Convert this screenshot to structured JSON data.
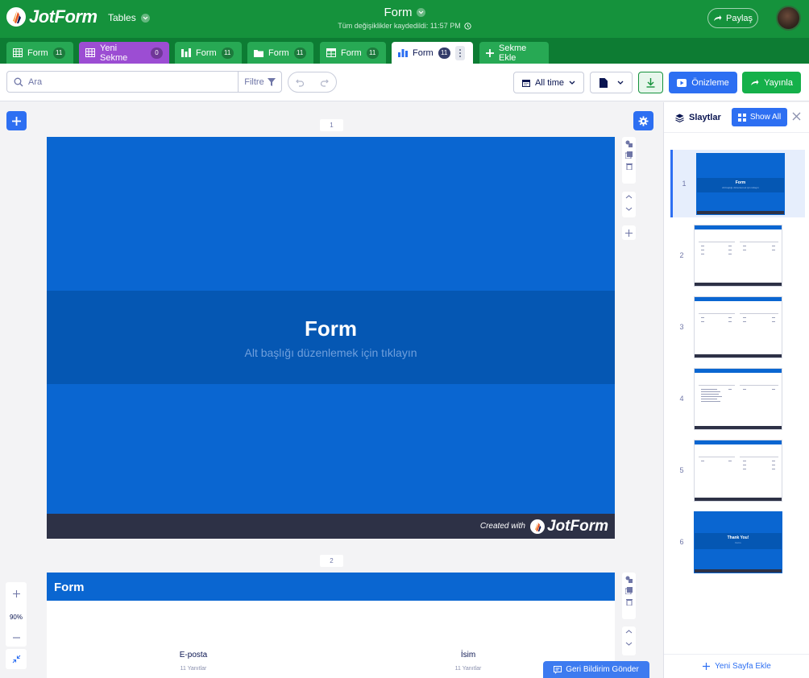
{
  "header": {
    "logo_text": "JotForm",
    "product": "Tables",
    "title": "Form",
    "saved_status": "Tüm değişiklikler kaydedildi: 11:57 PM",
    "share_label": "Paylaş"
  },
  "tabs": [
    {
      "label": "Form",
      "count": "11",
      "icon": "table-icon"
    },
    {
      "label": "Yeni Sekme",
      "count": "0",
      "icon": "table-icon"
    },
    {
      "label": "Form",
      "count": "11",
      "icon": "kanban-icon"
    },
    {
      "label": "Form",
      "count": "11",
      "icon": "folder-icon"
    },
    {
      "label": "Form",
      "count": "11",
      "icon": "grid-icon"
    },
    {
      "label": "Form",
      "count": "11",
      "icon": "bar-chart-icon"
    }
  ],
  "add_tab_label": "Sekme Ekle",
  "toolbar": {
    "search_placeholder": "Ara",
    "filter_label": "Filtre",
    "date_range": "All time",
    "preview_label": "Önizleme",
    "publish_label": "Yayınla"
  },
  "slides": {
    "slide1": {
      "number": "1",
      "title": "Form",
      "subtitle": "Alt başlığı düzenlemek için tıklayın",
      "footer_created": "Created with",
      "footer_brand": "JotForm"
    },
    "slide2": {
      "number": "2",
      "title": "Form",
      "col1_label": "E-posta",
      "col1_count": "11 Yanıtlar",
      "col2_label": "İsim",
      "col2_count": "11 Yanıtlar"
    }
  },
  "zoom_level": "90%",
  "feedback_label": "Geri Bildirim Gönder",
  "panel": {
    "title": "Slaytlar",
    "show_all_label": "Show All",
    "new_page_label": "Yeni Sayfa Ekle",
    "thumbnails": [
      {
        "number": "1",
        "type": "cover",
        "title": "Form",
        "subtitle": "Alt başlığı düzenlemek için tıklayın"
      },
      {
        "number": "2",
        "type": "table"
      },
      {
        "number": "3",
        "type": "table"
      },
      {
        "number": "4",
        "type": "table"
      },
      {
        "number": "5",
        "type": "table"
      },
      {
        "number": "6",
        "type": "cover",
        "title": "Thank You!",
        "subtitle": "Form"
      }
    ]
  },
  "colors": {
    "header_green": "#15923c",
    "accent_blue": "#2d6ff2",
    "slide_blue": "#0a66d1",
    "slide_band": "#0557b3",
    "tab_purple": "#9c4dd3"
  }
}
